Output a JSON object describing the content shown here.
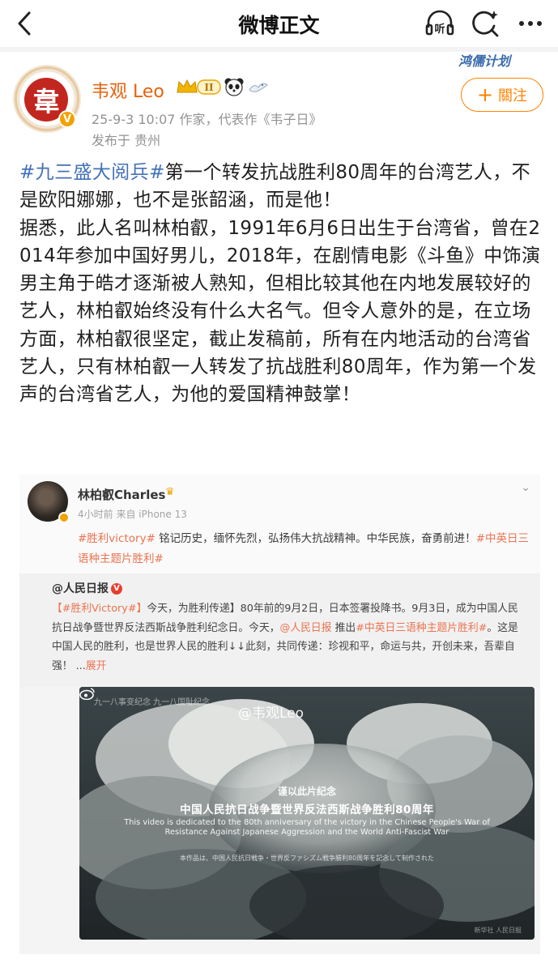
{
  "nav": {
    "title": "微博正文",
    "back_icon": "chevron-left-icon",
    "listen_label": "听",
    "icons": [
      "listen-icon",
      "search-icon",
      "more-icon"
    ]
  },
  "author": {
    "name": "韦观 Leo",
    "avatar_char": "韋",
    "level_badge": "II",
    "meta_line": "25-9-3 10:07  作家，代表作《韦子日》",
    "location": "发布于 贵州",
    "verified": "V"
  },
  "promo": {
    "label": "鸿儒计划"
  },
  "follow_button": {
    "plus": "+",
    "label": "關注"
  },
  "post": {
    "hashtag": "#九三盛大阅兵#",
    "text1": "第一个转发抗战胜利80周年的台湾艺人，不是欧阳娜娜，也不是张韶涵，而是他！",
    "text2": "据悉，此人名叫林柏叡，1991年6月6日出生于台湾省，曾在2014年参加中国好男儿，2018年，在剧情电影《斗鱼》中饰演男主角于皓才逐渐被人熟知，但相比较其他在内地发展较好的艺人，林柏叡始终没有什么大名气。但令人意外的是，在立场方面，林柏叡很坚定，截止发稿前，所有在内地活动的台湾省艺人，只有林柏叡一人转发了抗战胜利80周年，作为第一个发声的台湾省艺人，为他的爱国精神鼓掌！"
  },
  "embed": {
    "user": "林柏叡Charles",
    "crown": "♛",
    "meta": "4小时前  来自 iPhone 13",
    "text_tag1": "#胜利victory#",
    "text_body": " 铭记历史，缅怀先烈，弘扬伟大抗战精神。中华民族，奋勇前进！",
    "text_tag2": "#中英日三语种主题片胜利#",
    "repost_user": "@人民日报",
    "repost_v": "V",
    "repost_tag": "【#胜利Victory#】",
    "repost_text1": "今天，为胜利传递】80年前的9月2日，日本签署投降书。9月3日，成为中国人民抗日战争暨世界反法西斯战争胜利纪念日。今天，",
    "repost_mention": "@人民日报",
    "repost_text2": " 推出",
    "repost_tag2": "#中英日三语种主题片胜利#",
    "repost_text3": "。这是中国人民的胜利，也是世界人民的胜利↓↓此刻，共同传递：珍视和平，命运与共，开创未来，吾辈自强！ ...",
    "repost_more": "展开",
    "photo": {
      "watermark": "@韦观Leo",
      "top_left": "九一八事变纪念  九一八国耻纪念",
      "caption1": "谨以此片纪念",
      "caption2": "中国人民抗日战争暨世界反法西斯战争胜利80周年",
      "caption3": "This video is dedicated to the 80th anniversary of the victory in the Chinese People's War of Resistance Against Japanese Aggression and the World Anti-Fascist War",
      "caption4": "本作品は、中国人民抗日戦争・世界反ファシズム戦争勝利80周年を記念して制作された",
      "bottom_right": "新华社 人民日报"
    }
  }
}
